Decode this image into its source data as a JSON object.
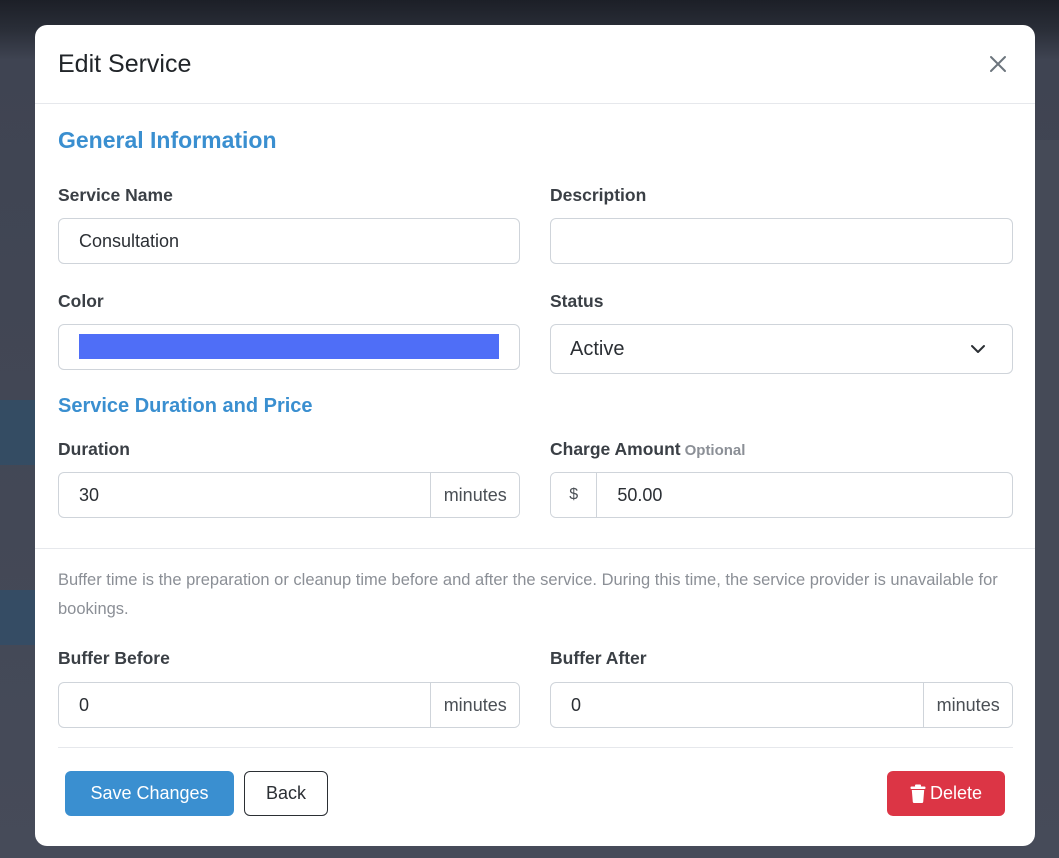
{
  "modal": {
    "title": "Edit Service"
  },
  "general": {
    "heading": "General Information",
    "service_name": {
      "label": "Service Name",
      "value": "Consultation"
    },
    "description": {
      "label": "Description",
      "value": ""
    },
    "color": {
      "label": "Color",
      "value": "#4f6ef7"
    },
    "status": {
      "label": "Status",
      "value": "Active"
    }
  },
  "duration_price": {
    "heading": "Service Duration and Price",
    "duration": {
      "label": "Duration",
      "value": "30",
      "unit": "minutes"
    },
    "charge": {
      "label": "Charge Amount",
      "optional": "Optional",
      "currency": "$",
      "value": "50.00"
    }
  },
  "buffer": {
    "help": "Buffer time is the preparation or cleanup time before and after the service. During this time, the service provider is unavailable for bookings.",
    "before": {
      "label": "Buffer Before",
      "value": "0",
      "unit": "minutes"
    },
    "after": {
      "label": "Buffer After",
      "value": "0",
      "unit": "minutes"
    }
  },
  "actions": {
    "save": "Save Changes",
    "back": "Back",
    "delete": "Delete"
  },
  "colors": {
    "accent": "#3a8fd0",
    "danger": "#dc3545",
    "swatch": "#4f6ef7"
  }
}
